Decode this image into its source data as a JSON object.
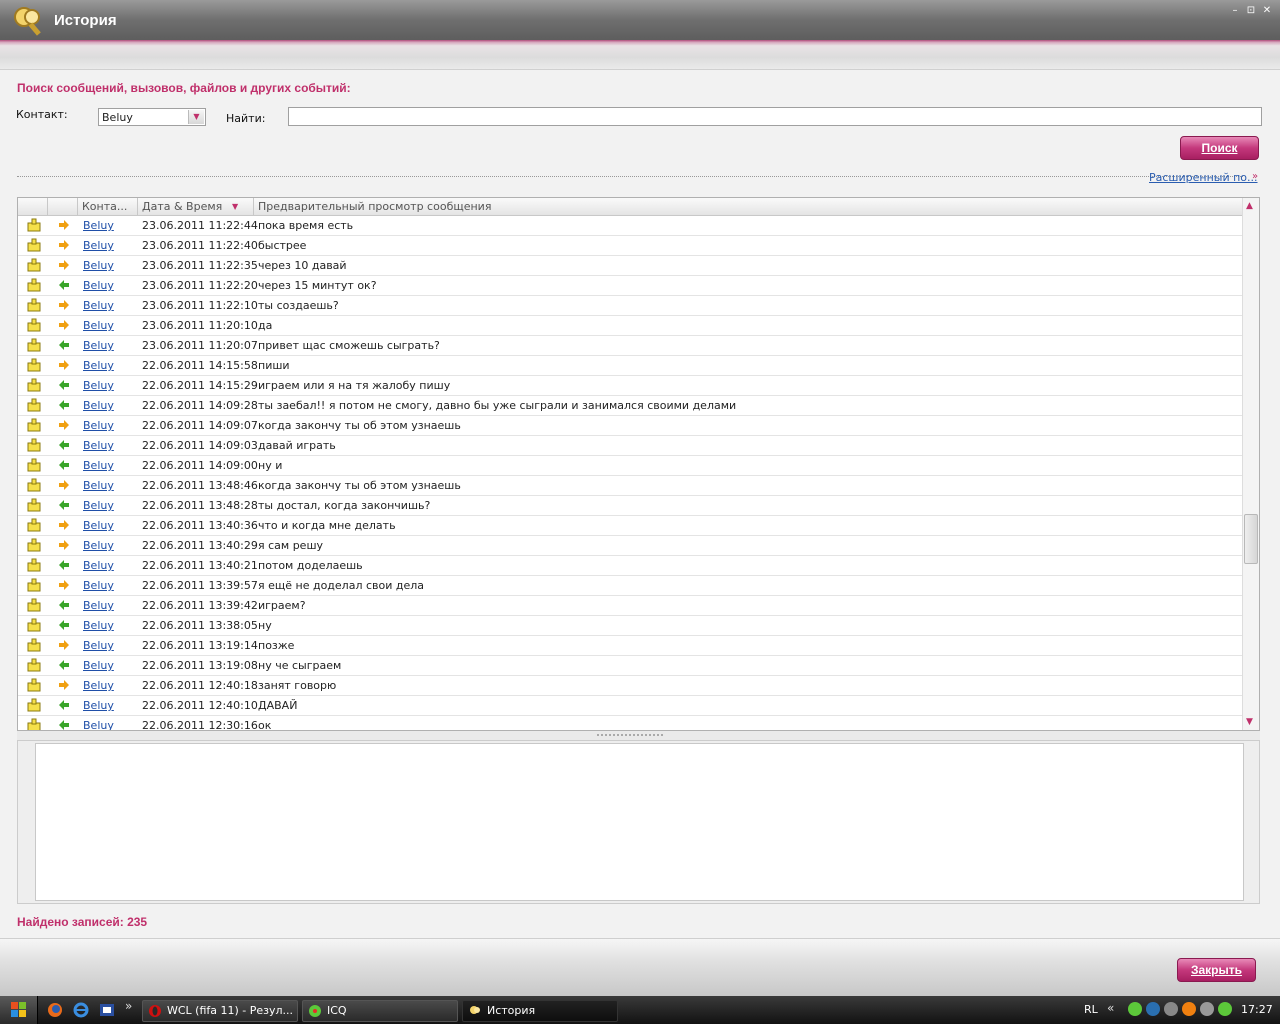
{
  "window": {
    "title": "История",
    "minimize": "–",
    "restore": "⊡",
    "close": "✕"
  },
  "search": {
    "heading": "Поиск сообщений, вызовов, файлов и других событий:",
    "contact_label": "Контакт:",
    "contact_value": "Beluy",
    "find_label": "Найти:",
    "find_value": "",
    "search_button": "Поиск",
    "advanced_link": "Расширенный по..."
  },
  "grid": {
    "columns": [
      "",
      "",
      "Конта...",
      "Дата & Время",
      "Предварительный просмотр сообщения"
    ],
    "rows": [
      {
        "dir": "out",
        "contact": "Beluy",
        "datetime": "23.06.2011 11:22:44",
        "message": "пока время есть"
      },
      {
        "dir": "out",
        "contact": "Beluy",
        "datetime": "23.06.2011 11:22:40",
        "message": "быстрее"
      },
      {
        "dir": "out",
        "contact": "Beluy",
        "datetime": "23.06.2011 11:22:35",
        "message": "через 10 давай"
      },
      {
        "dir": "in",
        "contact": "Beluy",
        "datetime": "23.06.2011 11:22:20",
        "message": "через 15 минтут ок?"
      },
      {
        "dir": "out",
        "contact": "Beluy",
        "datetime": "23.06.2011 11:22:10",
        "message": "ты создаешь?"
      },
      {
        "dir": "out",
        "contact": "Beluy",
        "datetime": "23.06.2011 11:20:10",
        "message": "да"
      },
      {
        "dir": "in",
        "contact": "Beluy",
        "datetime": "23.06.2011 11:20:07",
        "message": "привет щас сможешь сыграть?"
      },
      {
        "dir": "out",
        "contact": "Beluy",
        "datetime": "22.06.2011 14:15:58",
        "message": "пиши"
      },
      {
        "dir": "in",
        "contact": "Beluy",
        "datetime": "22.06.2011 14:15:29",
        "message": "играем или я на тя жалобу пишу"
      },
      {
        "dir": "in",
        "contact": "Beluy",
        "datetime": "22.06.2011 14:09:28",
        "message": "ты заебал!! я потом не смогу, давно бы уже сыграли и занимался своими делами"
      },
      {
        "dir": "out",
        "contact": "Beluy",
        "datetime": "22.06.2011 14:09:07",
        "message": "когда закончу ты об этом узнаешь"
      },
      {
        "dir": "in",
        "contact": "Beluy",
        "datetime": "22.06.2011 14:09:03",
        "message": "давай играть"
      },
      {
        "dir": "in",
        "contact": "Beluy",
        "datetime": "22.06.2011 14:09:00",
        "message": "ну и"
      },
      {
        "dir": "out",
        "contact": "Beluy",
        "datetime": "22.06.2011 13:48:46",
        "message": "когда закончу ты об этом узнаешь"
      },
      {
        "dir": "in",
        "contact": "Beluy",
        "datetime": "22.06.2011 13:48:28",
        "message": "ты достал, когда закончишь?"
      },
      {
        "dir": "out",
        "contact": "Beluy",
        "datetime": "22.06.2011 13:40:36",
        "message": "что и когда мне делать"
      },
      {
        "dir": "out",
        "contact": "Beluy",
        "datetime": "22.06.2011 13:40:29",
        "message": "я сам решу"
      },
      {
        "dir": "in",
        "contact": "Beluy",
        "datetime": "22.06.2011 13:40:21",
        "message": "потом доделаешь"
      },
      {
        "dir": "out",
        "contact": "Beluy",
        "datetime": "22.06.2011 13:39:57",
        "message": "я ещё не доделал свои дела"
      },
      {
        "dir": "in",
        "contact": "Beluy",
        "datetime": "22.06.2011 13:39:42",
        "message": "играем?"
      },
      {
        "dir": "in",
        "contact": "Beluy",
        "datetime": "22.06.2011 13:38:05",
        "message": "ну"
      },
      {
        "dir": "out",
        "contact": "Beluy",
        "datetime": "22.06.2011 13:19:14",
        "message": "позже"
      },
      {
        "dir": "in",
        "contact": "Beluy",
        "datetime": "22.06.2011 13:19:08",
        "message": "ну че сыграем"
      },
      {
        "dir": "out",
        "contact": "Beluy",
        "datetime": "22.06.2011 12:40:18",
        "message": "занят говорю"
      },
      {
        "dir": "in",
        "contact": "Beluy",
        "datetime": "22.06.2011 12:40:10",
        "message": "ДАВАЙ"
      },
      {
        "dir": "in",
        "contact": "Beluy",
        "datetime": "22.06.2011 12:30:16",
        "message": "ок"
      }
    ]
  },
  "status": {
    "found": "Найдено записей: 235"
  },
  "footer": {
    "close_button": "Закрыть"
  },
  "taskbar": {
    "tasks": [
      "WCL (fifa 11) - Резул...",
      "ICQ",
      "История"
    ],
    "lang": "RL",
    "clock": "17:27",
    "chevron": "»",
    "tray_chevron": "«"
  },
  "icons": {
    "incoming": "arrow-left-icon",
    "outgoing": "arrow-right-icon",
    "message": "message-type-icon"
  },
  "colors": {
    "accent": "#c0306b",
    "link": "#1f4fa8",
    "incoming_arrow": "#3aa52a",
    "outgoing_arrow": "#f0a010"
  }
}
